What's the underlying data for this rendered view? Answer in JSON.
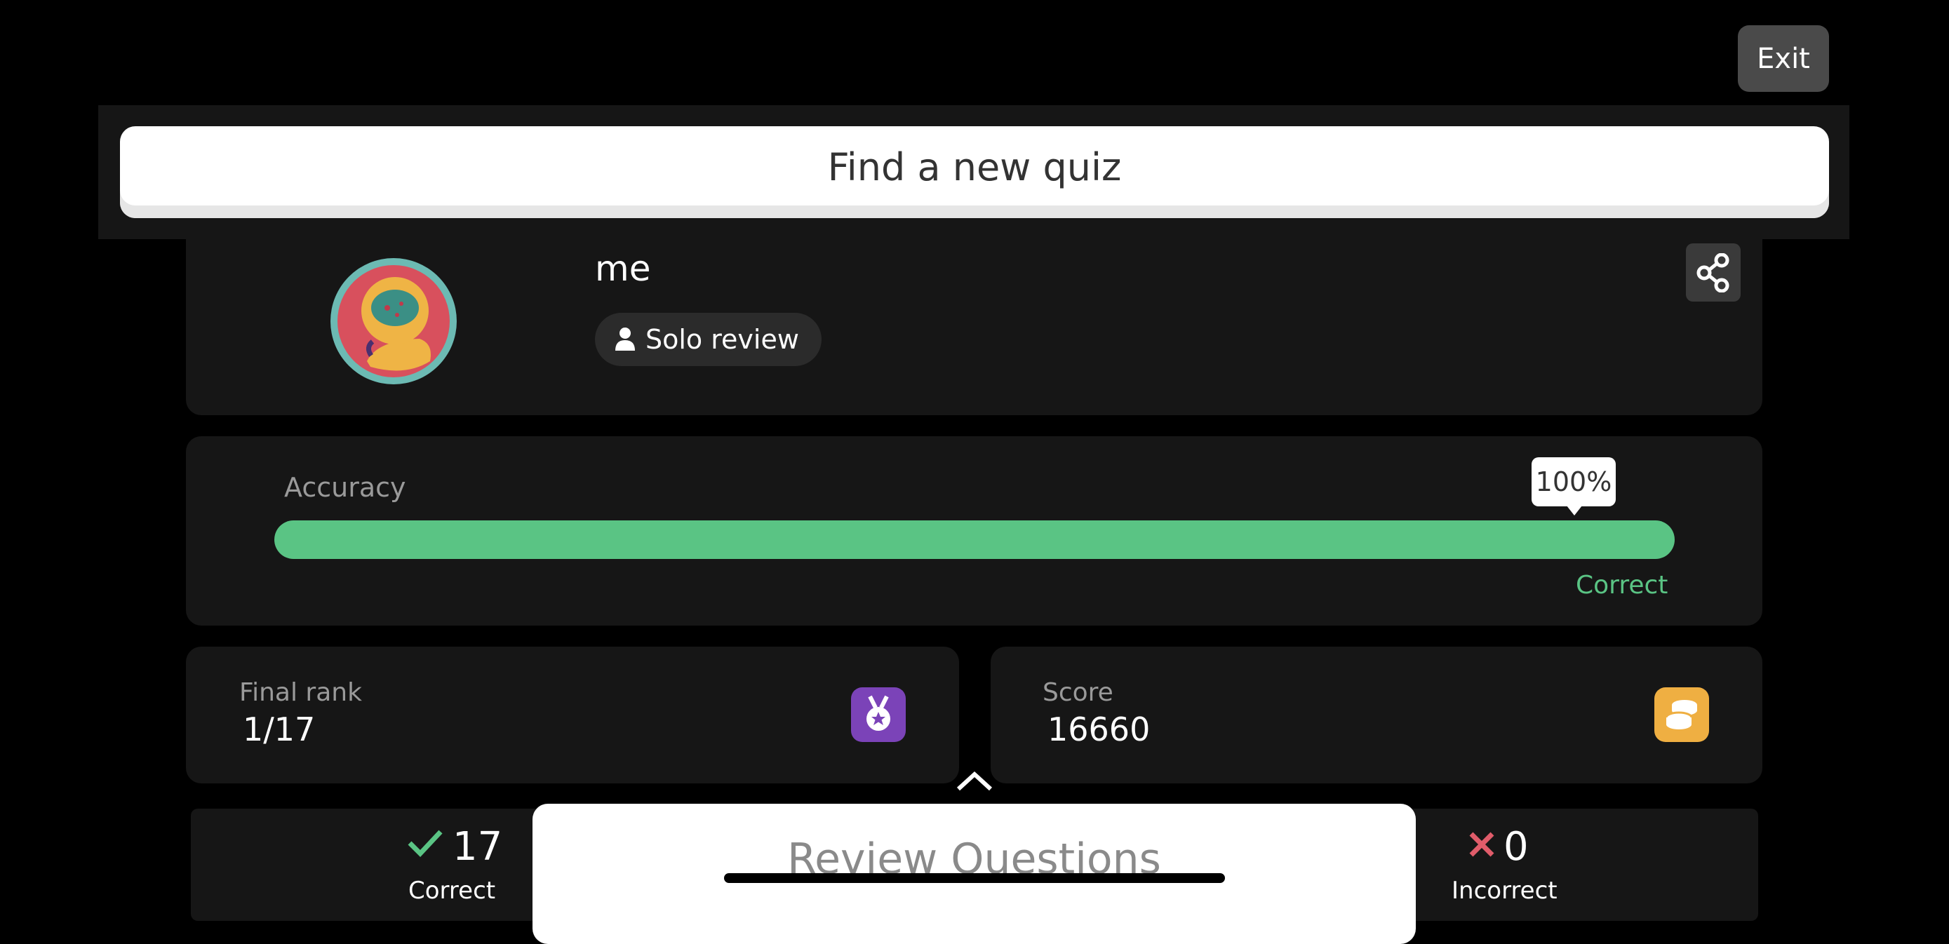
{
  "header": {
    "exit_label": "Exit",
    "find_quiz_label": "Find a new quiz"
  },
  "profile": {
    "name": "me",
    "mode_label": "Solo review"
  },
  "accuracy": {
    "label": "Accuracy",
    "percent_label": "100%",
    "percent": 100,
    "legend_label": "Correct",
    "bar_color": "#5ac484"
  },
  "stats": {
    "rank": {
      "label": "Final rank",
      "value": "1/17",
      "badge_color": "#7b43b8"
    },
    "score": {
      "label": "Score",
      "value": "16660",
      "badge_color": "#efaf42"
    }
  },
  "results": {
    "correct": {
      "count": "17",
      "label": "Correct",
      "color": "#5ac484"
    },
    "incorrect": {
      "count": "0",
      "label": "Incorrect",
      "color": "#e05c6a"
    }
  },
  "review": {
    "label": "Review Questions"
  },
  "icons": [
    "share-icon",
    "user-icon",
    "medal-icon",
    "coins-icon",
    "check-icon",
    "cross-icon",
    "chevron-up-icon"
  ]
}
